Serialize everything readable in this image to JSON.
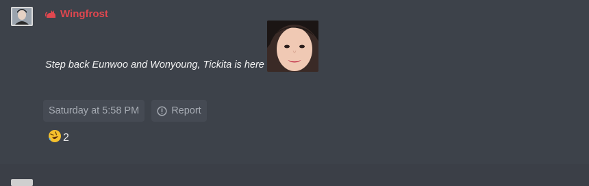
{
  "message": {
    "author": {
      "name": "Wingfrost",
      "name_color": "#e1474f",
      "badge_icon": "cat-icon",
      "avatar": "user-avatar"
    },
    "text": "Step back Eunwoo and Wonyoung, Tickita is here",
    "emote": "face-emote-image",
    "timestamp": "Saturday at 5:58 PM",
    "report_label": "Report",
    "report_icon": "alert-circle-icon",
    "reaction": {
      "icon": "laughing-emoji-icon",
      "count": "2"
    }
  },
  "next_message": {
    "avatar": "user-avatar"
  }
}
